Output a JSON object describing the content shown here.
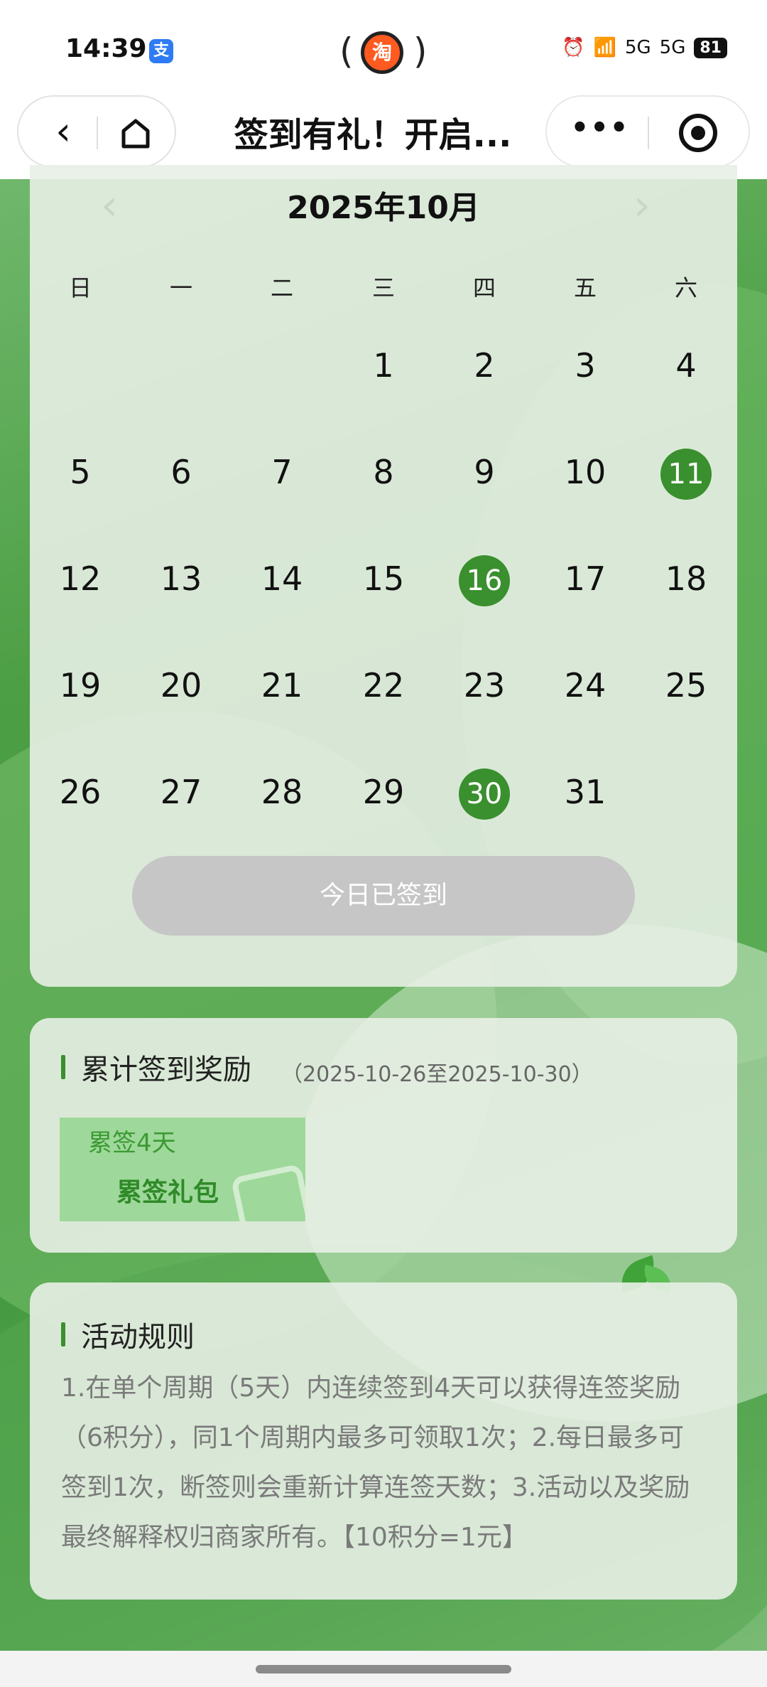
{
  "status_bar": {
    "time": "14:39",
    "alipay_badge": "支",
    "center_app_icon": "淘",
    "signal_label_1": "5G",
    "signal_label_2": "5G",
    "battery": "81"
  },
  "nav": {
    "title": "签到有礼！开启...",
    "back_icon": "chevron-left",
    "home_icon": "home",
    "more_icon": "more-dots",
    "close_icon": "target-circle"
  },
  "calendar": {
    "month_label": "2025年10月",
    "prev_arrow": "‹",
    "next_arrow": "›",
    "weekdays": [
      "日",
      "一",
      "二",
      "三",
      "四",
      "五",
      "六"
    ],
    "first_weekday_index": 3,
    "days": [
      "1",
      "2",
      "3",
      "4",
      "5",
      "6",
      "7",
      "8",
      "9",
      "10",
      "11",
      "12",
      "13",
      "14",
      "15",
      "16",
      "17",
      "18",
      "19",
      "20",
      "21",
      "22",
      "23",
      "24",
      "25",
      "26",
      "27",
      "28",
      "29",
      "30",
      "31"
    ],
    "signed_days": [
      11,
      16,
      30
    ],
    "signed_color": "#3a8f2e",
    "button_label": "今日已签到"
  },
  "reward": {
    "title": "累计签到奖励",
    "date_range": "（2025-10-26至2025-10-30）",
    "gift": {
      "condition": "累签4天",
      "name": "累签礼包"
    }
  },
  "rules": {
    "title": "活动规则",
    "text": "1.在单个周期（5天）内连续签到4天可以获得连签奖励（6积分），同1个周期内最多可领取1次；2.每日最多可签到1次，断签则会重新计算连签天数；3.活动以及奖励最终解释权归商家所有。【10积分=1元】"
  },
  "colors": {
    "accent": "#3a8f2e",
    "button_disabled": "#c6c6c6"
  }
}
